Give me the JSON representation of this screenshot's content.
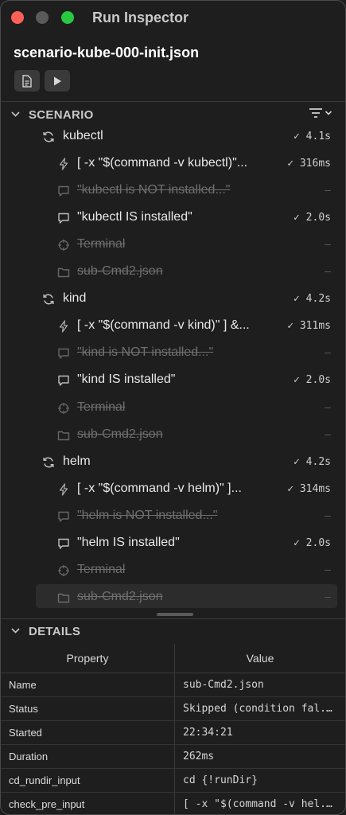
{
  "window": {
    "title": "Run Inspector"
  },
  "file_title": "scenario-kube-000-init.json",
  "scenario": {
    "label": "SCENARIO",
    "rows": [
      {
        "level": 1,
        "icon": "loop-icon",
        "text": "kubectl",
        "status": "✓ 4.1s",
        "skipped": false
      },
      {
        "level": 2,
        "icon": "bolt-icon",
        "text": "[ -x \"$(command -v kubectl)\"...",
        "status": "✓ 316ms",
        "skipped": false
      },
      {
        "level": 2,
        "icon": "comment-icon",
        "text": "\"kubectl is NOT installed...\"",
        "status": "–",
        "skipped": true
      },
      {
        "level": 2,
        "icon": "comment-icon",
        "text": "\"kubectl IS installed\"",
        "status": "✓ 2.0s",
        "skipped": false
      },
      {
        "level": 2,
        "icon": "crosshair-icon",
        "text": "Terminal",
        "status": "–",
        "skipped": true
      },
      {
        "level": 2,
        "icon": "folder-icon",
        "text": "sub-Cmd2.json",
        "status": "–",
        "skipped": true
      },
      {
        "level": 1,
        "icon": "loop-icon",
        "text": "kind",
        "status": "✓ 4.2s",
        "skipped": false
      },
      {
        "level": 2,
        "icon": "bolt-icon",
        "text": "[ -x \"$(command -v kind)\" ] &...",
        "status": "✓ 311ms",
        "skipped": false
      },
      {
        "level": 2,
        "icon": "comment-icon",
        "text": "\"kind is NOT installed...\"",
        "status": "–",
        "skipped": true
      },
      {
        "level": 2,
        "icon": "comment-icon",
        "text": "\"kind IS installed\"",
        "status": "✓ 2.0s",
        "skipped": false
      },
      {
        "level": 2,
        "icon": "crosshair-icon",
        "text": "Terminal",
        "status": "–",
        "skipped": true
      },
      {
        "level": 2,
        "icon": "folder-icon",
        "text": "sub-Cmd2.json",
        "status": "–",
        "skipped": true
      },
      {
        "level": 1,
        "icon": "loop-icon",
        "text": "helm",
        "status": "✓ 4.2s",
        "skipped": false
      },
      {
        "level": 2,
        "icon": "bolt-icon",
        "text": "[ -x \"$(command -v helm)\" ]...",
        "status": "✓ 314ms",
        "skipped": false
      },
      {
        "level": 2,
        "icon": "comment-icon",
        "text": "\"helm is NOT installed...\"",
        "status": "–",
        "skipped": true
      },
      {
        "level": 2,
        "icon": "comment-icon",
        "text": "\"helm IS installed\"",
        "status": "✓ 2.0s",
        "skipped": false
      },
      {
        "level": 2,
        "icon": "crosshair-icon",
        "text": "Terminal",
        "status": "–",
        "skipped": true
      },
      {
        "level": 2,
        "icon": "folder-icon",
        "text": "sub-Cmd2.json",
        "status": "–",
        "skipped": true,
        "selected": true
      }
    ]
  },
  "details": {
    "label": "DETAILS",
    "columns": [
      "Property",
      "Value"
    ],
    "rows": [
      {
        "key": "Name",
        "value": "sub-Cmd2.json"
      },
      {
        "key": "Status",
        "value": "Skipped (condition fal..."
      },
      {
        "key": "Started",
        "value": "22:34:21"
      },
      {
        "key": "Duration",
        "value": "262ms"
      },
      {
        "key": "cd_rundir_input",
        "value": "cd {!runDir}"
      },
      {
        "key": "check_pre_input",
        "value": "[ -x \"$(command -v hel..."
      }
    ]
  }
}
